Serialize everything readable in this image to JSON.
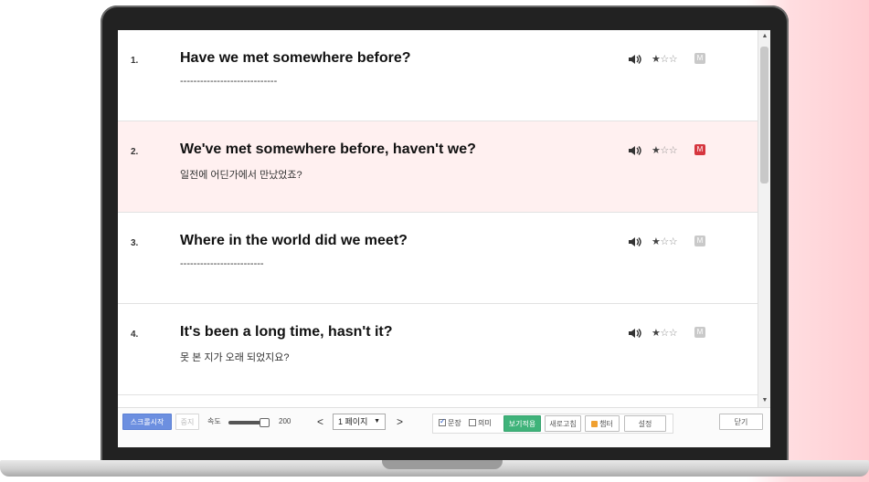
{
  "items": [
    {
      "num": "1.",
      "sentence": "Have we met somewhere before?",
      "meaning": "-----------------------------",
      "difficulty_stars": 1,
      "marked": false,
      "highlighted": false
    },
    {
      "num": "2.",
      "sentence": "We've met somewhere before, haven't we?",
      "meaning": "일전에 어딘가에서 만났었죠?",
      "difficulty_stars": 1,
      "marked": true,
      "highlighted": true
    },
    {
      "num": "3.",
      "sentence": "Where in the world did we meet?",
      "meaning": "-------------------------",
      "difficulty_stars": 1,
      "marked": false,
      "highlighted": false
    },
    {
      "num": "4.",
      "sentence": "It's been a long time, hasn't it?",
      "meaning": "못 본 지가 오래 되었지요?",
      "difficulty_stars": 1,
      "marked": false,
      "highlighted": false
    }
  ],
  "stars": {
    "on": "★",
    "off": "☆☆"
  },
  "mark_label": "M",
  "toolbar": {
    "scroll_start": "스크롤시작",
    "stop": "중지",
    "speed_label": "속도",
    "speed_value": "200",
    "prev": "<",
    "page_select": "1 페이지",
    "next": ">",
    "sentence_label": "문장",
    "sentence_checked": true,
    "meaning_label": "의미",
    "meaning_checked": false,
    "apply_view": "보기적용",
    "refresh": "새로고침",
    "chapter": "챕터",
    "settings": "설정",
    "close": "닫기"
  },
  "colors": {
    "accent_blue": "#6c8fe0",
    "accent_green": "#3fb37a",
    "mark_red": "#d6363f",
    "highlight_row": "#fff0f0"
  }
}
